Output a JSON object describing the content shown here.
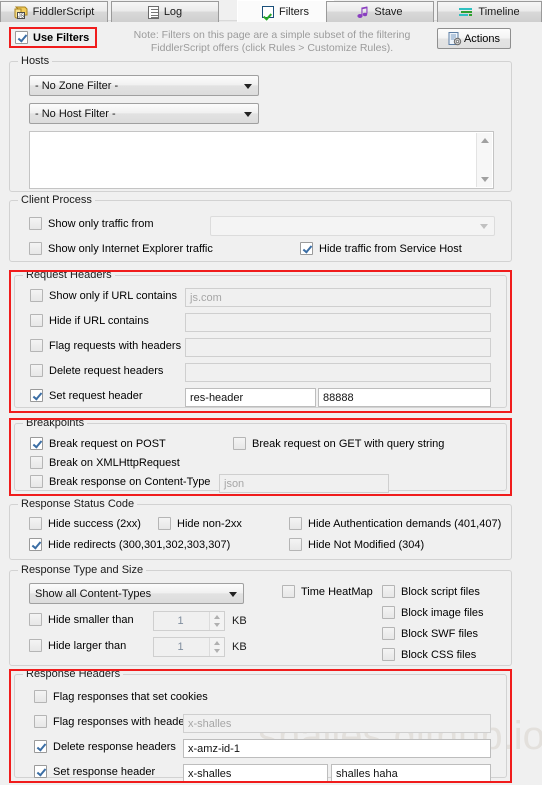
{
  "tabs": [
    {
      "label": "FiddlerScript",
      "icon": "fiddlerscript-icon",
      "active": false
    },
    {
      "label": "Log",
      "icon": "log-icon",
      "active": false
    },
    {
      "label": "Filters",
      "icon": "checkmark-icon",
      "active": true
    },
    {
      "label": "Stave",
      "icon": "music-note-icon",
      "active": false
    },
    {
      "label": "Timeline",
      "icon": "timeline-icon",
      "active": false
    }
  ],
  "header": {
    "use_filters_label": "Use Filters",
    "use_filters_checked": true,
    "note_line1": "Note: Filters on this page are a simple subset of the filtering",
    "note_line2": "FiddlerScript offers (click Rules > Customize Rules).",
    "actions_label": "Actions",
    "actions_icon": "document-gear-icon"
  },
  "hosts": {
    "legend": "Hosts",
    "zone_filter": "- No Zone Filter -",
    "host_filter": "- No Host Filter -",
    "host_list_value": ""
  },
  "client_process": {
    "legend": "Client Process",
    "show_only_traffic_from": {
      "label": "Show only traffic from",
      "checked": false,
      "value": ""
    },
    "show_only_ie_traffic": {
      "label": "Show only Internet Explorer traffic",
      "checked": false
    },
    "hide_service_host": {
      "label": "Hide traffic from Service Host",
      "checked": true
    }
  },
  "request_headers": {
    "legend": "Request Headers",
    "highlighted": true,
    "rows": [
      {
        "label": "Show only if URL contains",
        "checked": false,
        "value": "js.com",
        "enabled": false
      },
      {
        "label": "Hide if URL contains",
        "checked": false,
        "value": "",
        "enabled": false
      },
      {
        "label": "Flag requests with headers",
        "checked": false,
        "value": "",
        "enabled": false
      },
      {
        "label": "Delete request headers",
        "checked": false,
        "value": "",
        "enabled": false
      },
      {
        "label": "Set request header",
        "checked": true,
        "value": "res-header",
        "value2": "88888",
        "enabled": true
      }
    ]
  },
  "breakpoints": {
    "legend": "Breakpoints",
    "highlighted": true,
    "break_on_post": {
      "label": "Break request on POST",
      "checked": true
    },
    "break_on_get_query": {
      "label": "Break request on GET with query string",
      "checked": false
    },
    "break_on_xhr": {
      "label": "Break on XMLHttpRequest",
      "checked": false
    },
    "break_on_content_type": {
      "label": "Break response on Content-Type",
      "checked": false,
      "value": "json",
      "enabled": false
    }
  },
  "response_status": {
    "legend": "Response Status Code",
    "hide_success": {
      "label": "Hide success (2xx)",
      "checked": false
    },
    "hide_non2xx": {
      "label": "Hide non-2xx",
      "checked": false
    },
    "hide_auth": {
      "label": "Hide Authentication demands (401,407)",
      "checked": false
    },
    "hide_redirects": {
      "label": "Hide redirects (300,301,302,303,307)",
      "checked": true
    },
    "hide_not_modified": {
      "label": "Hide Not Modified (304)",
      "checked": false
    }
  },
  "response_type": {
    "legend": "Response Type and Size",
    "content_type": "Show all Content-Types",
    "hide_smaller": {
      "label": "Hide smaller than",
      "checked": false,
      "value": "1",
      "unit": "KB"
    },
    "hide_larger": {
      "label": "Hide larger than",
      "checked": false,
      "value": "1",
      "unit": "KB"
    },
    "time_heatmap": {
      "label": "Time HeatMap",
      "checked": false
    },
    "block_script": {
      "label": "Block script files",
      "checked": false
    },
    "block_image": {
      "label": "Block image files",
      "checked": false
    },
    "block_swf": {
      "label": "Block SWF files",
      "checked": false
    },
    "block_css": {
      "label": "Block CSS files",
      "checked": false
    }
  },
  "response_headers": {
    "legend": "Response Headers",
    "highlighted": true,
    "flag_set_cookies": {
      "label": "Flag responses that set cookies",
      "checked": false
    },
    "flag_with_headers": {
      "label": "Flag responses with headers",
      "checked": false,
      "value": "x-shalles",
      "enabled": false
    },
    "delete_headers": {
      "label": "Delete response headers",
      "checked": true,
      "value": "x-amz-id-1",
      "enabled": true
    },
    "set_header": {
      "label": "Set response header",
      "checked": true,
      "value": "x-shalles",
      "value2": "shalles haha",
      "enabled": true
    }
  },
  "watermark": {
    "text": "shalles.github.io"
  },
  "colors": {
    "highlight_red": "#f01c1c",
    "accent_check": "#3b6ea5",
    "note_gray": "#9b9b9b"
  }
}
